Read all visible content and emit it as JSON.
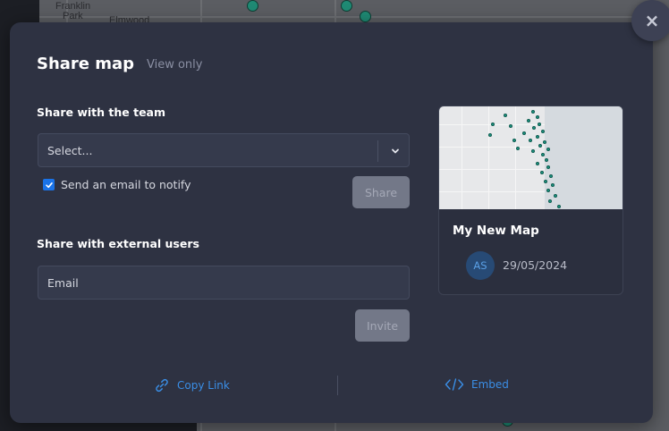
{
  "background_map": {
    "labels": [
      "Franklin",
      "Park",
      "Elmwood"
    ]
  },
  "modal": {
    "title": "Share map",
    "subtitle": "View only",
    "close_label": "×",
    "team_section": {
      "label": "Share with the team",
      "select_placeholder": "Select...",
      "notify_label": "Send an email to notify",
      "notify_checked": true,
      "share_button": "Share"
    },
    "external_section": {
      "label": "Share with external users",
      "email_placeholder": "Email",
      "invite_button": "Invite"
    },
    "map_card": {
      "title": "My New Map",
      "avatar_initials": "AS",
      "date": "29/05/2024"
    },
    "footer": {
      "copy_link": "Copy Link",
      "embed": "Embed"
    }
  },
  "colors": {
    "modal_bg": "#2e3242",
    "accent": "#1a73e8",
    "link": "#3a8ee6",
    "disabled_button": "#737888",
    "map_point": "#1f8a74"
  }
}
